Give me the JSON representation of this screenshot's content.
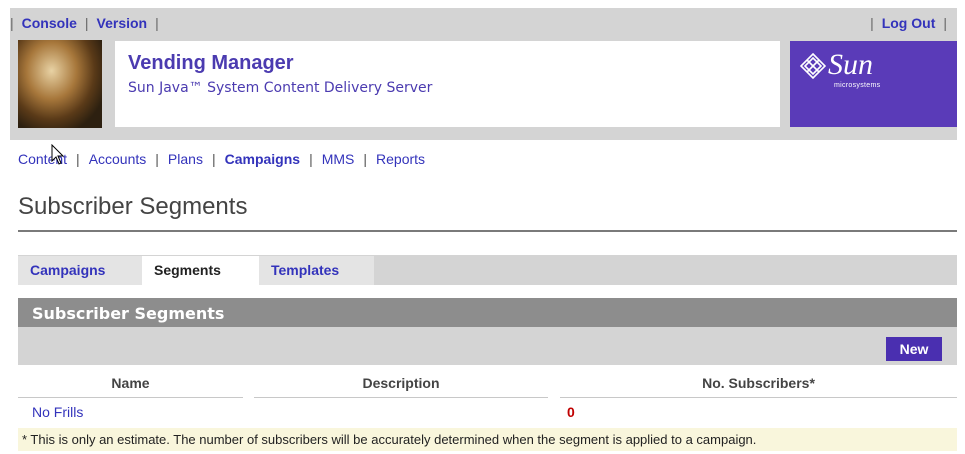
{
  "topnav": {
    "console": "Console",
    "version": "Version",
    "logout": "Log Out",
    "separator": "|"
  },
  "header": {
    "title": "Vending Manager",
    "subtitle": "Sun Java™ System Content Delivery Server",
    "logo_text": "Sun",
    "logo_subtext": "microsystems"
  },
  "subnav": {
    "items": [
      {
        "label": "Content",
        "active": false
      },
      {
        "label": "Accounts",
        "active": false
      },
      {
        "label": "Plans",
        "active": false
      },
      {
        "label": "Campaigns",
        "active": true
      },
      {
        "label": "MMS",
        "active": false
      },
      {
        "label": "Reports",
        "active": false
      }
    ],
    "separator": "|"
  },
  "page": {
    "title": "Subscriber Segments"
  },
  "tabs": [
    {
      "label": "Campaigns",
      "active": false
    },
    {
      "label": "Segments",
      "active": true
    },
    {
      "label": "Templates",
      "active": false
    }
  ],
  "section": {
    "title": "Subscriber Segments",
    "new_label": "New"
  },
  "table": {
    "headers": [
      "Name",
      "Description",
      "No. Subscribers*"
    ],
    "rows": [
      {
        "name": "No Frills",
        "description": "",
        "subscribers": "0"
      }
    ]
  },
  "footnote": "* This is only an estimate. The number of subscribers will be accurately determined when the segment is applied to a campaign.",
  "colors": {
    "link": "#3333bb",
    "accent": "#4a2fb0",
    "count": "#c00000"
  }
}
